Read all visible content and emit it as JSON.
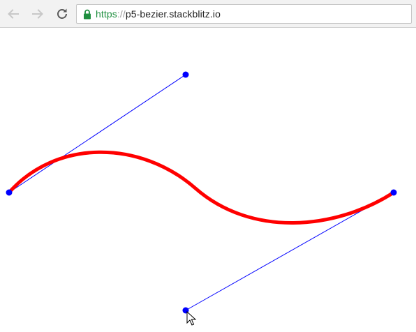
{
  "browser": {
    "url_scheme": "https",
    "url_separator": "://",
    "url_host": "p5-bezier.stackblitz.io",
    "icons": {
      "back": "arrow-left-icon",
      "forward": "arrow-right-icon",
      "reload": "reload-icon",
      "secure": "lock-icon"
    },
    "colors": {
      "secure": "#1e8e3e",
      "disabled_nav": "#c8c8c8",
      "active_nav": "#5a5a5a"
    }
  },
  "sketch": {
    "curve_color": "#ff0000",
    "control_line_color": "#0000ff",
    "point_color": "#0000ff"
  }
}
